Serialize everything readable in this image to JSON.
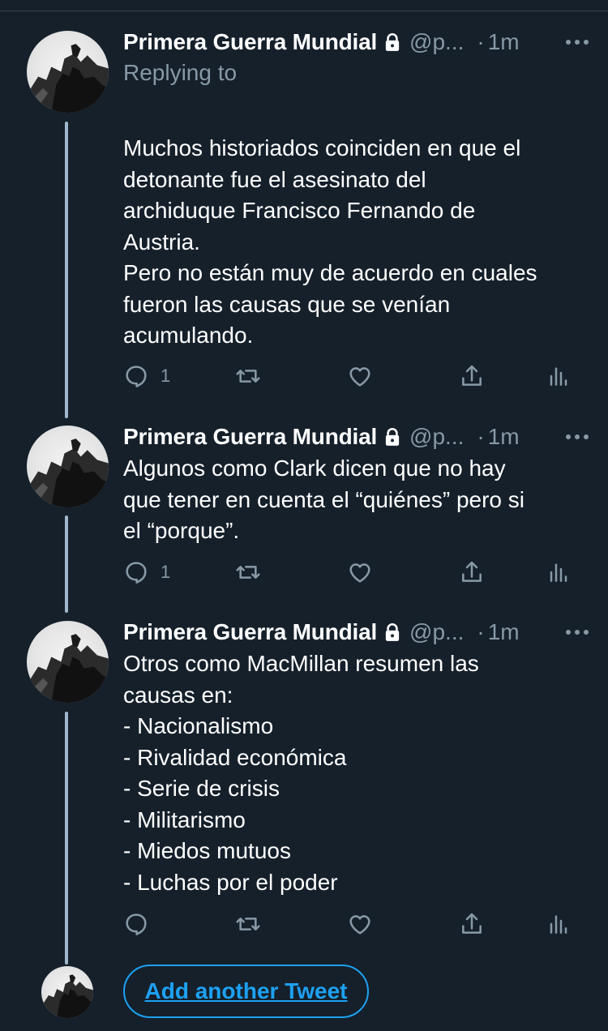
{
  "colors": {
    "background": "#15202b",
    "text": "#ffffff",
    "secondary_text": "#8899a6",
    "accent": "#1da1f2",
    "thread_line": "#9fb7cc"
  },
  "tweets": [
    {
      "name": "Primera Guerra Mundial",
      "handle": "@p...",
      "separator": "·",
      "time": "1m",
      "replying_to": "Replying to",
      "lines": [
        "Muchos historiados coinciden en que el",
        "detonante fue el asesinato del",
        "archiduque Francisco Fernando de",
        "Austria.",
        "Pero no están muy de acuerdo en cuales",
        "fueron las causas que se venían",
        "acumulando."
      ],
      "reply_count": "1",
      "icons": [
        "reply-icon",
        "retweet-icon",
        "like-icon",
        "share-icon",
        "analytics-icon"
      ]
    },
    {
      "name": "Primera Guerra Mundial",
      "handle": "@p...",
      "separator": "·",
      "time": "1m",
      "lines": [
        "Algunos como Clark dicen que no hay",
        "que tener en cuenta el “quiénes” pero si",
        "el “porque”."
      ],
      "reply_count": "1",
      "icons": [
        "reply-icon",
        "retweet-icon",
        "like-icon",
        "share-icon",
        "analytics-icon"
      ]
    },
    {
      "name": "Primera Guerra Mundial",
      "handle": "@p...",
      "separator": "·",
      "time": "1m",
      "lines": [
        "Otros como MacMillan resumen las",
        "causas en:",
        "- Nacionalismo",
        "- Rivalidad económica",
        "- Serie de crisis",
        "- Militarismo",
        "- Miedos mutuos",
        "- Luchas por el poder"
      ],
      "reply_count": "",
      "icons": [
        "reply-icon",
        "retweet-icon",
        "like-icon",
        "share-icon",
        "analytics-icon"
      ]
    }
  ],
  "add_tweet": {
    "label": "Add another Tweet"
  }
}
